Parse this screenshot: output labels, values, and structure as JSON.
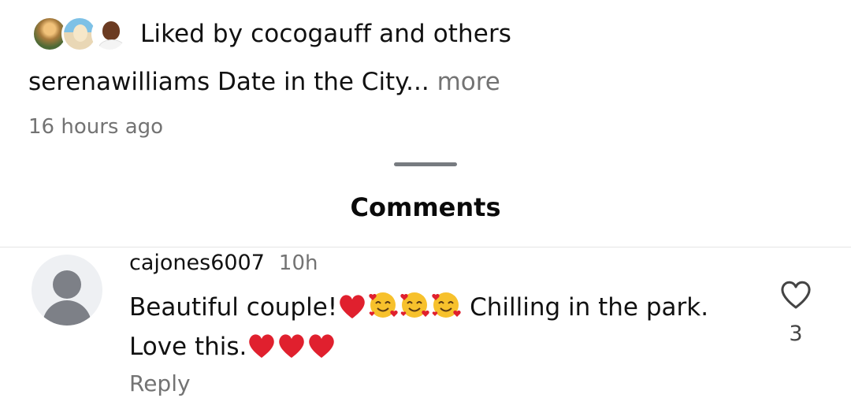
{
  "likes": {
    "liked_text": "Liked by cocogauff and others",
    "avatars": [
      "liker-avatar-1",
      "liker-avatar-2",
      "liker-avatar-3"
    ]
  },
  "caption": {
    "text": "serenawilliams Date in the City...",
    "more": "more"
  },
  "post_time": "16 hours ago",
  "comments_title": "Comments",
  "comment": {
    "username": "cajones6007",
    "time": "10h",
    "text_part1": "Beautiful couple!",
    "text_part2": " Chilling in the park.",
    "text_part3": "Love this.",
    "like_count": "3",
    "reply_label": "Reply",
    "avatar_icon": "default-user-icon",
    "like_icon": "heart-outline-icon"
  },
  "colors": {
    "secondary_text": "#737373",
    "heart_red": "#e0202e"
  }
}
